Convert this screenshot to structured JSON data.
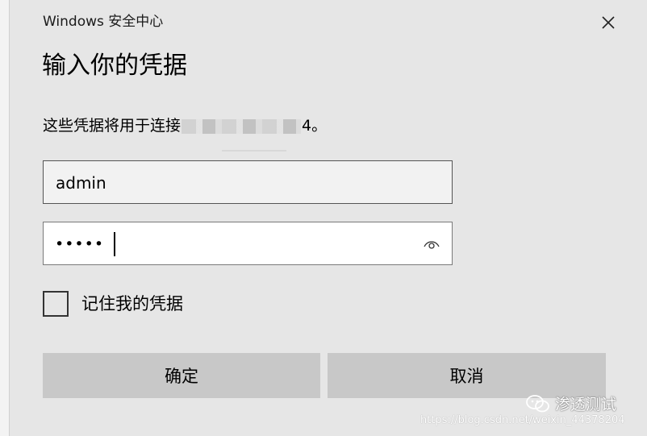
{
  "window": {
    "app_title": "Windows 安全中心",
    "close_icon": "close-icon"
  },
  "dialog": {
    "heading": "输入你的凭据",
    "description_prefix": "这些凭据将用于连接",
    "description_suffix": "4。"
  },
  "form": {
    "username_value": "admin",
    "password_mask": "•••••",
    "reveal_icon": "eye-icon",
    "remember_label": "记住我的凭据",
    "remember_checked": false
  },
  "buttons": {
    "ok_label": "确定",
    "cancel_label": "取消"
  },
  "watermark": {
    "brand": "渗透测试",
    "brand_icon": "wechat-icon",
    "url": "https://blog.csdn.net/weixin_44378204"
  },
  "colors": {
    "background": "#e6e6e6",
    "button": "#c8c8c8",
    "input_border": "#555555"
  }
}
